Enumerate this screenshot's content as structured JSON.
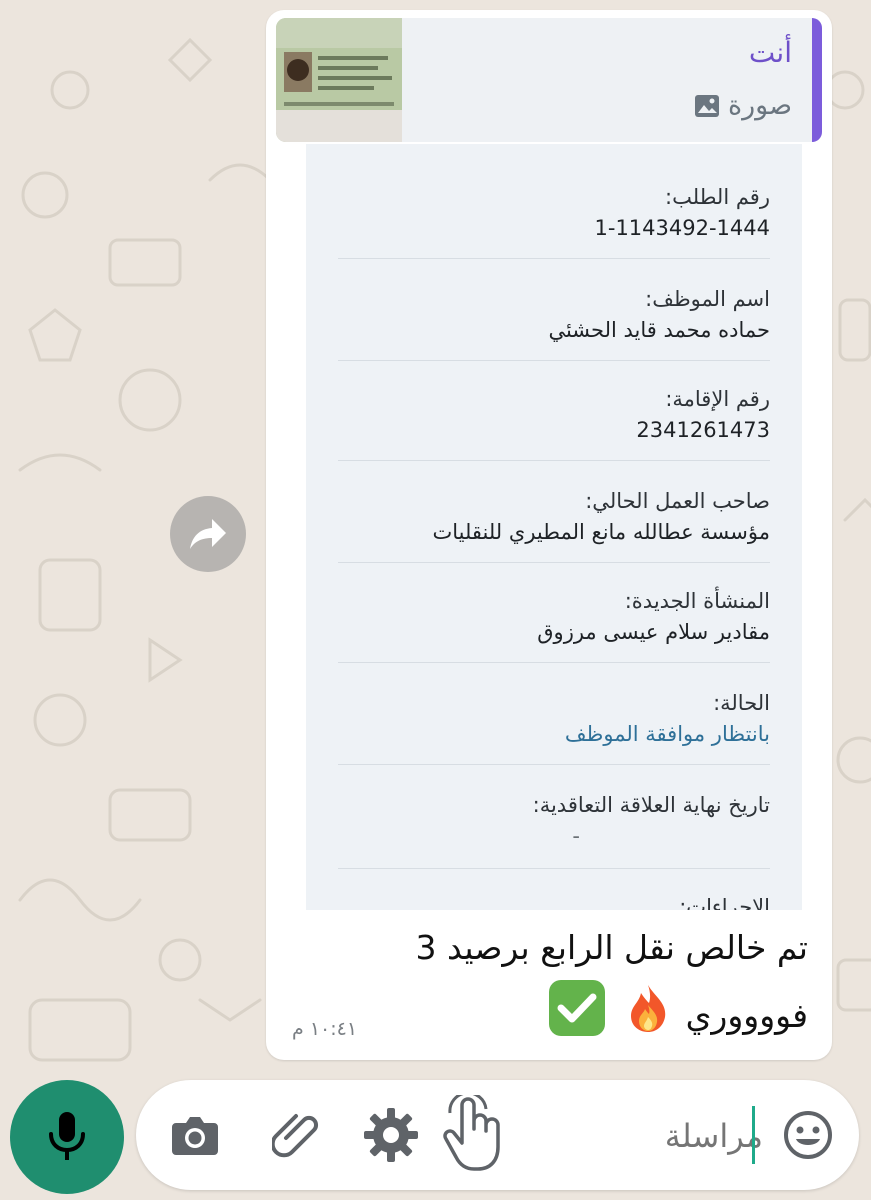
{
  "quoted": {
    "author": "أنت",
    "type_label": "صورة",
    "type_icon": "image-icon"
  },
  "card": {
    "fields": [
      {
        "label": "رقم الطلب:",
        "value": "1-1143492-1444"
      },
      {
        "label": "اسم الموظف:",
        "value": "حماده محمد قايد الحشئي"
      },
      {
        "label": "رقم الإقامة:",
        "value": "2341261473"
      },
      {
        "label": "صاحب العمل الحالي:",
        "value": "مؤسسة عطالله مانع المطيري للنقليات"
      },
      {
        "label": "المنشأة الجديدة:",
        "value": "مقادير سلام عيسى مرزوق"
      },
      {
        "label": "الحالة:",
        "value": "بانتظار موافقة الموظف"
      },
      {
        "label": "تاريخ نهاية العلاقة التعاقدية:",
        "value": "-"
      },
      {
        "label": "الإجراءات:",
        "value": ""
      }
    ]
  },
  "message": {
    "line1": "تم خالص نقل الرابع برصيد 3",
    "line2": "فووووري",
    "emojis": [
      "fire-emoji",
      "check-mark-emoji"
    ],
    "time": "١٠:٤١ م"
  },
  "composer": {
    "placeholder": "مراسلة",
    "icons": [
      "emoji-icon",
      "hand-pointer-icon",
      "gear-icon",
      "paperclip-icon",
      "camera-icon",
      "microphone-icon"
    ]
  },
  "colors": {
    "bubble": "#ffffff",
    "quote_bar": "#7c5cdb",
    "status": "#2e7098",
    "mic": "#1f8e6f",
    "caret": "#1faa8a"
  }
}
